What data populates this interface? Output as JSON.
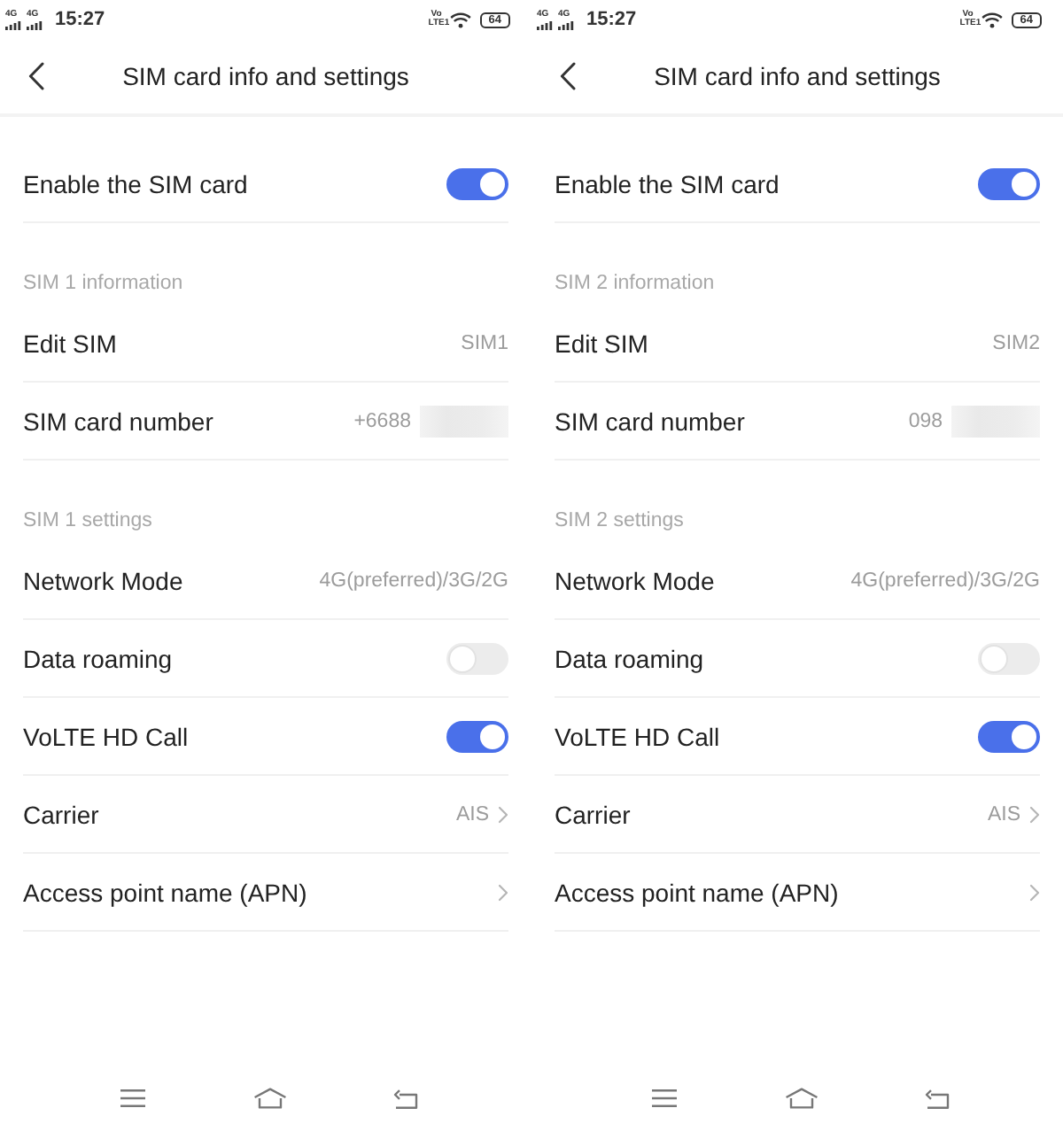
{
  "panels": [
    {
      "status_bar": {
        "signals": [
          {
            "label": "4G"
          },
          {
            "label": "4G"
          }
        ],
        "time": "15:27",
        "volte": "Vo LTE1",
        "battery": "64"
      },
      "header": {
        "title": "SIM card info and settings"
      },
      "sections": [
        {
          "rows": [
            {
              "kind": "toggle",
              "label": "Enable the SIM card",
              "on": true
            }
          ]
        },
        {
          "title": "SIM 1 information",
          "rows": [
            {
              "kind": "value",
              "label": "Edit SIM",
              "value": "SIM1"
            },
            {
              "kind": "redacted",
              "label": "SIM card number",
              "value": "+6688"
            }
          ]
        },
        {
          "title": "SIM 1 settings",
          "rows": [
            {
              "kind": "value",
              "label": "Network Mode",
              "value": "4G(preferred)/3G/2G"
            },
            {
              "kind": "toggle",
              "label": "Data roaming",
              "on": false
            },
            {
              "kind": "toggle",
              "label": "VoLTE HD Call",
              "on": true
            },
            {
              "kind": "link",
              "label": "Carrier",
              "value": "AIS"
            },
            {
              "kind": "link",
              "label": "Access point name (APN)"
            }
          ]
        }
      ]
    },
    {
      "status_bar": {
        "signals": [
          {
            "label": "4G"
          },
          {
            "label": "4G"
          }
        ],
        "time": "15:27",
        "volte": "Vo LTE1",
        "battery": "64"
      },
      "header": {
        "title": "SIM card info and settings"
      },
      "sections": [
        {
          "rows": [
            {
              "kind": "toggle",
              "label": "Enable the SIM card",
              "on": true
            }
          ]
        },
        {
          "title": "SIM 2 information",
          "rows": [
            {
              "kind": "value",
              "label": "Edit SIM",
              "value": "SIM2"
            },
            {
              "kind": "redacted",
              "label": "SIM card number",
              "value": "098"
            }
          ]
        },
        {
          "title": "SIM 2 settings",
          "rows": [
            {
              "kind": "value",
              "label": "Network Mode",
              "value": "4G(preferred)/3G/2G"
            },
            {
              "kind": "toggle",
              "label": "Data roaming",
              "on": false
            },
            {
              "kind": "toggle",
              "label": "VoLTE HD Call",
              "on": true
            },
            {
              "kind": "link",
              "label": "Carrier",
              "value": "AIS"
            },
            {
              "kind": "link",
              "label": "Access point name (APN)"
            }
          ]
        }
      ]
    }
  ]
}
